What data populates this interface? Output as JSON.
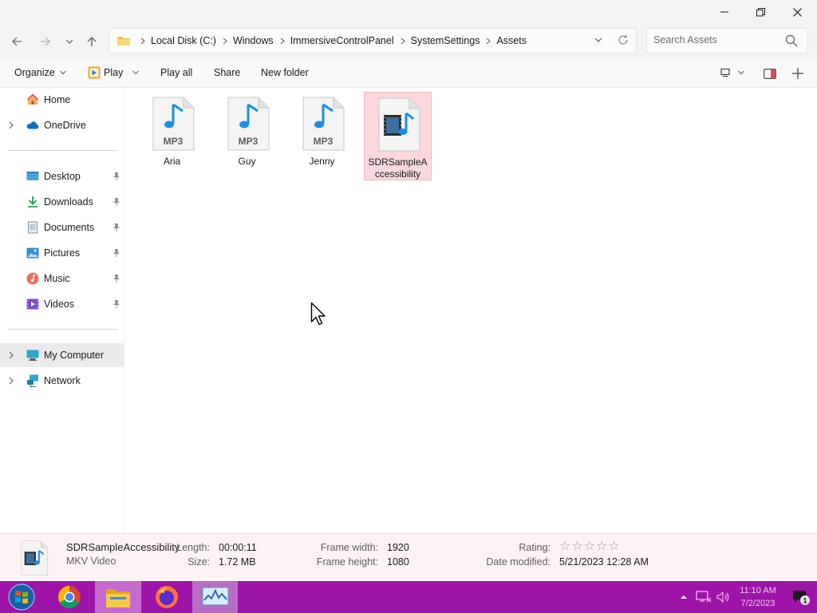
{
  "window": {
    "minimize_icon": "minimize-icon",
    "maximize_icon": "restore-icon",
    "close_icon": "close-icon"
  },
  "navigation": {
    "back_icon": "arrow-left-icon",
    "forward_icon": "arrow-right-icon",
    "recent_icon": "chevron-down-icon",
    "up_icon": "arrow-up-icon"
  },
  "address": {
    "breadcrumbs": [
      "Local Disk (C:)",
      "Windows",
      "ImmersiveControlPanel",
      "SystemSettings",
      "Assets"
    ]
  },
  "search": {
    "placeholder": "Search Assets"
  },
  "toolbar": {
    "organize": "Organize",
    "play": "Play",
    "play_all": "Play all",
    "share": "Share",
    "new_folder": "New folder"
  },
  "sidebar": {
    "items": [
      {
        "label": "Home"
      },
      {
        "label": "OneDrive"
      },
      {
        "label": "Desktop"
      },
      {
        "label": "Downloads"
      },
      {
        "label": "Documents"
      },
      {
        "label": "Pictures"
      },
      {
        "label": "Music"
      },
      {
        "label": "Videos"
      },
      {
        "label": "My Computer"
      },
      {
        "label": "Network"
      }
    ]
  },
  "files": [
    {
      "name": "Aria",
      "type_badge": "MP3"
    },
    {
      "name": "Guy",
      "type_badge": "MP3"
    },
    {
      "name": "Jenny",
      "type_badge": "MP3"
    },
    {
      "name": "SDRSampleAccessibility",
      "type_badge": ""
    }
  ],
  "details": {
    "file_name": "SDRSampleAccessibility",
    "file_type": "MKV Video",
    "length_label": "Length:",
    "length_value": "00:00:11",
    "size_label": "Size:",
    "size_value": "1.72 MB",
    "frame_width_label": "Frame width:",
    "frame_width_value": "1920",
    "frame_height_label": "Frame height:",
    "frame_height_value": "1080",
    "rating_label": "Rating:",
    "rating_value": 0,
    "date_modified_label": "Date modified:",
    "date_modified_value": "5/21/2023 12:28 AM"
  },
  "taskbar": {
    "clock_time": "11:10 AM",
    "clock_date": "7/2/2023",
    "notification_count": "1",
    "accent_color": "#9d14a8"
  }
}
